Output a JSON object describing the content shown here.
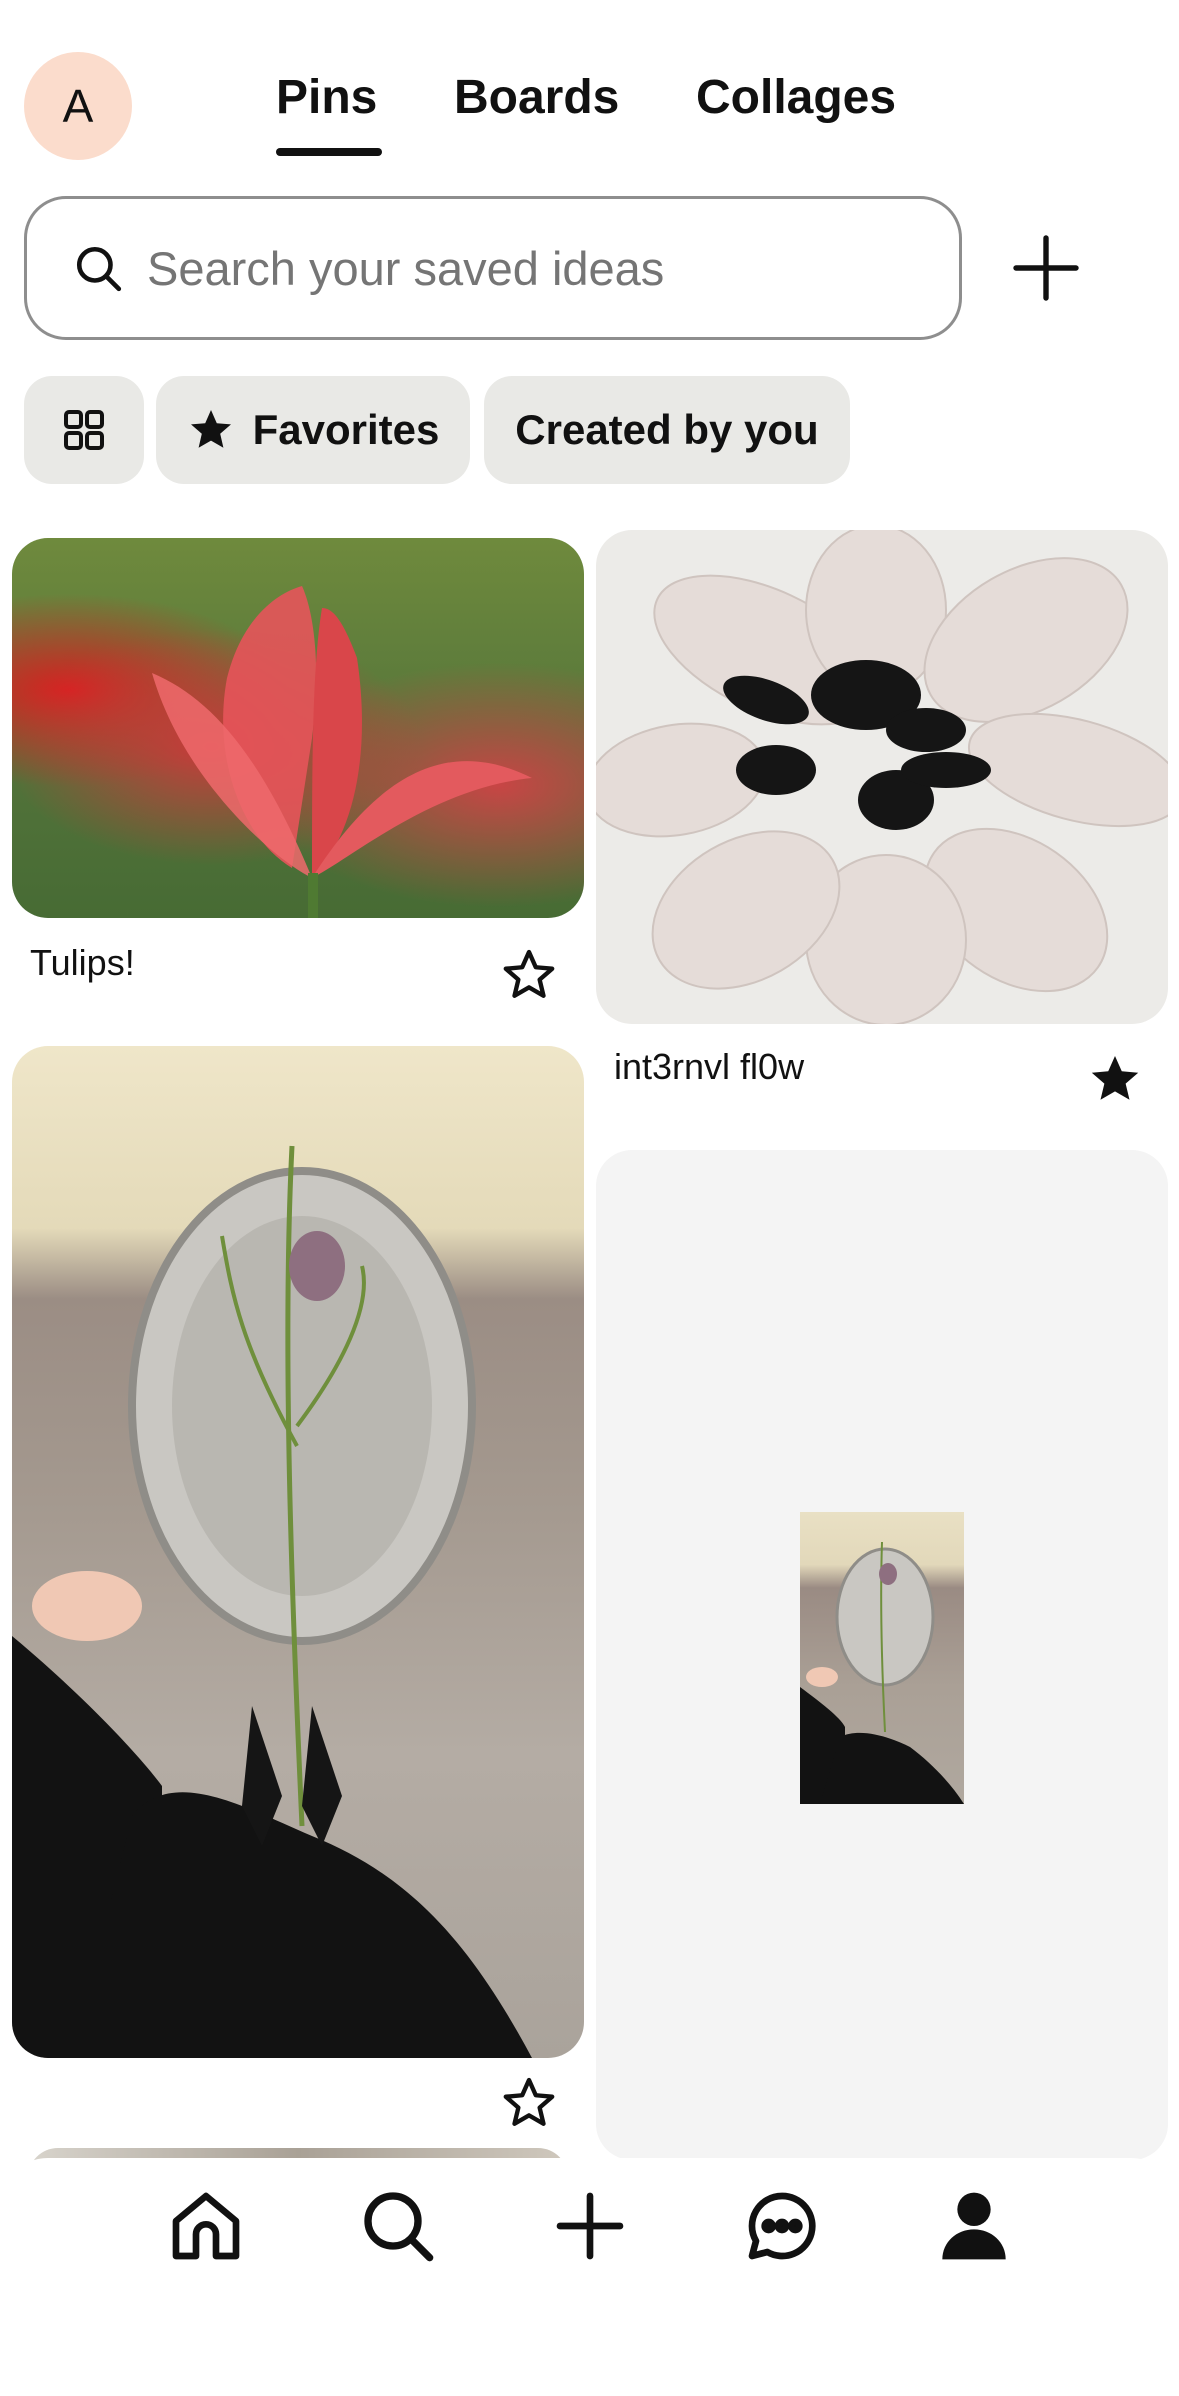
{
  "header": {
    "avatar_initial": "A",
    "tabs": [
      {
        "label": "Pins",
        "active": true
      },
      {
        "label": "Boards",
        "active": false
      },
      {
        "label": "Collages",
        "active": false
      }
    ]
  },
  "search": {
    "placeholder": "Search your saved ideas",
    "icon": "search-icon"
  },
  "filters": {
    "grid_icon": "grid-icon",
    "favorites_label": "Favorites",
    "created_label": "Created by you"
  },
  "pins": [
    {
      "label": "Tulips!",
      "favorited": false
    },
    {
      "label": "int3rnvl fl0w",
      "favorited": true
    },
    {
      "label": "",
      "favorited": false
    }
  ],
  "nav": {
    "items": [
      "home-icon",
      "search-icon",
      "create-icon",
      "messages-icon",
      "profile-icon"
    ]
  },
  "colors": {
    "avatar_bg": "#fbdccc",
    "chip_bg": "#e9e9e6",
    "text": "#111111"
  }
}
